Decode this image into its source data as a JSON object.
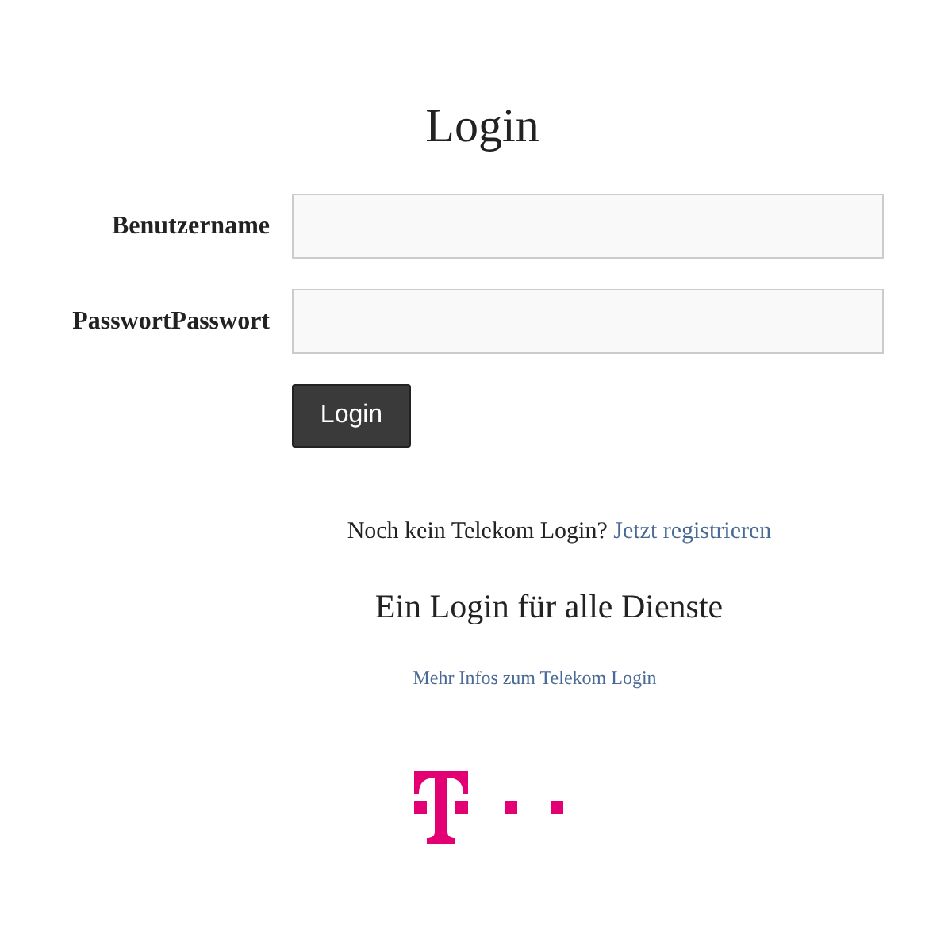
{
  "title": "Login",
  "fields": [
    {
      "label": "Benutzername"
    },
    {
      "label": "PasswortPasswort"
    }
  ],
  "submit_button": "Login",
  "register_prompt": {
    "text": "Noch kein Telekom Login?",
    "link": "Jetzt registrieren"
  },
  "tagline": "Ein Login für alle Dienste",
  "info_link": "Mehr Infos zum Telekom Login"
}
